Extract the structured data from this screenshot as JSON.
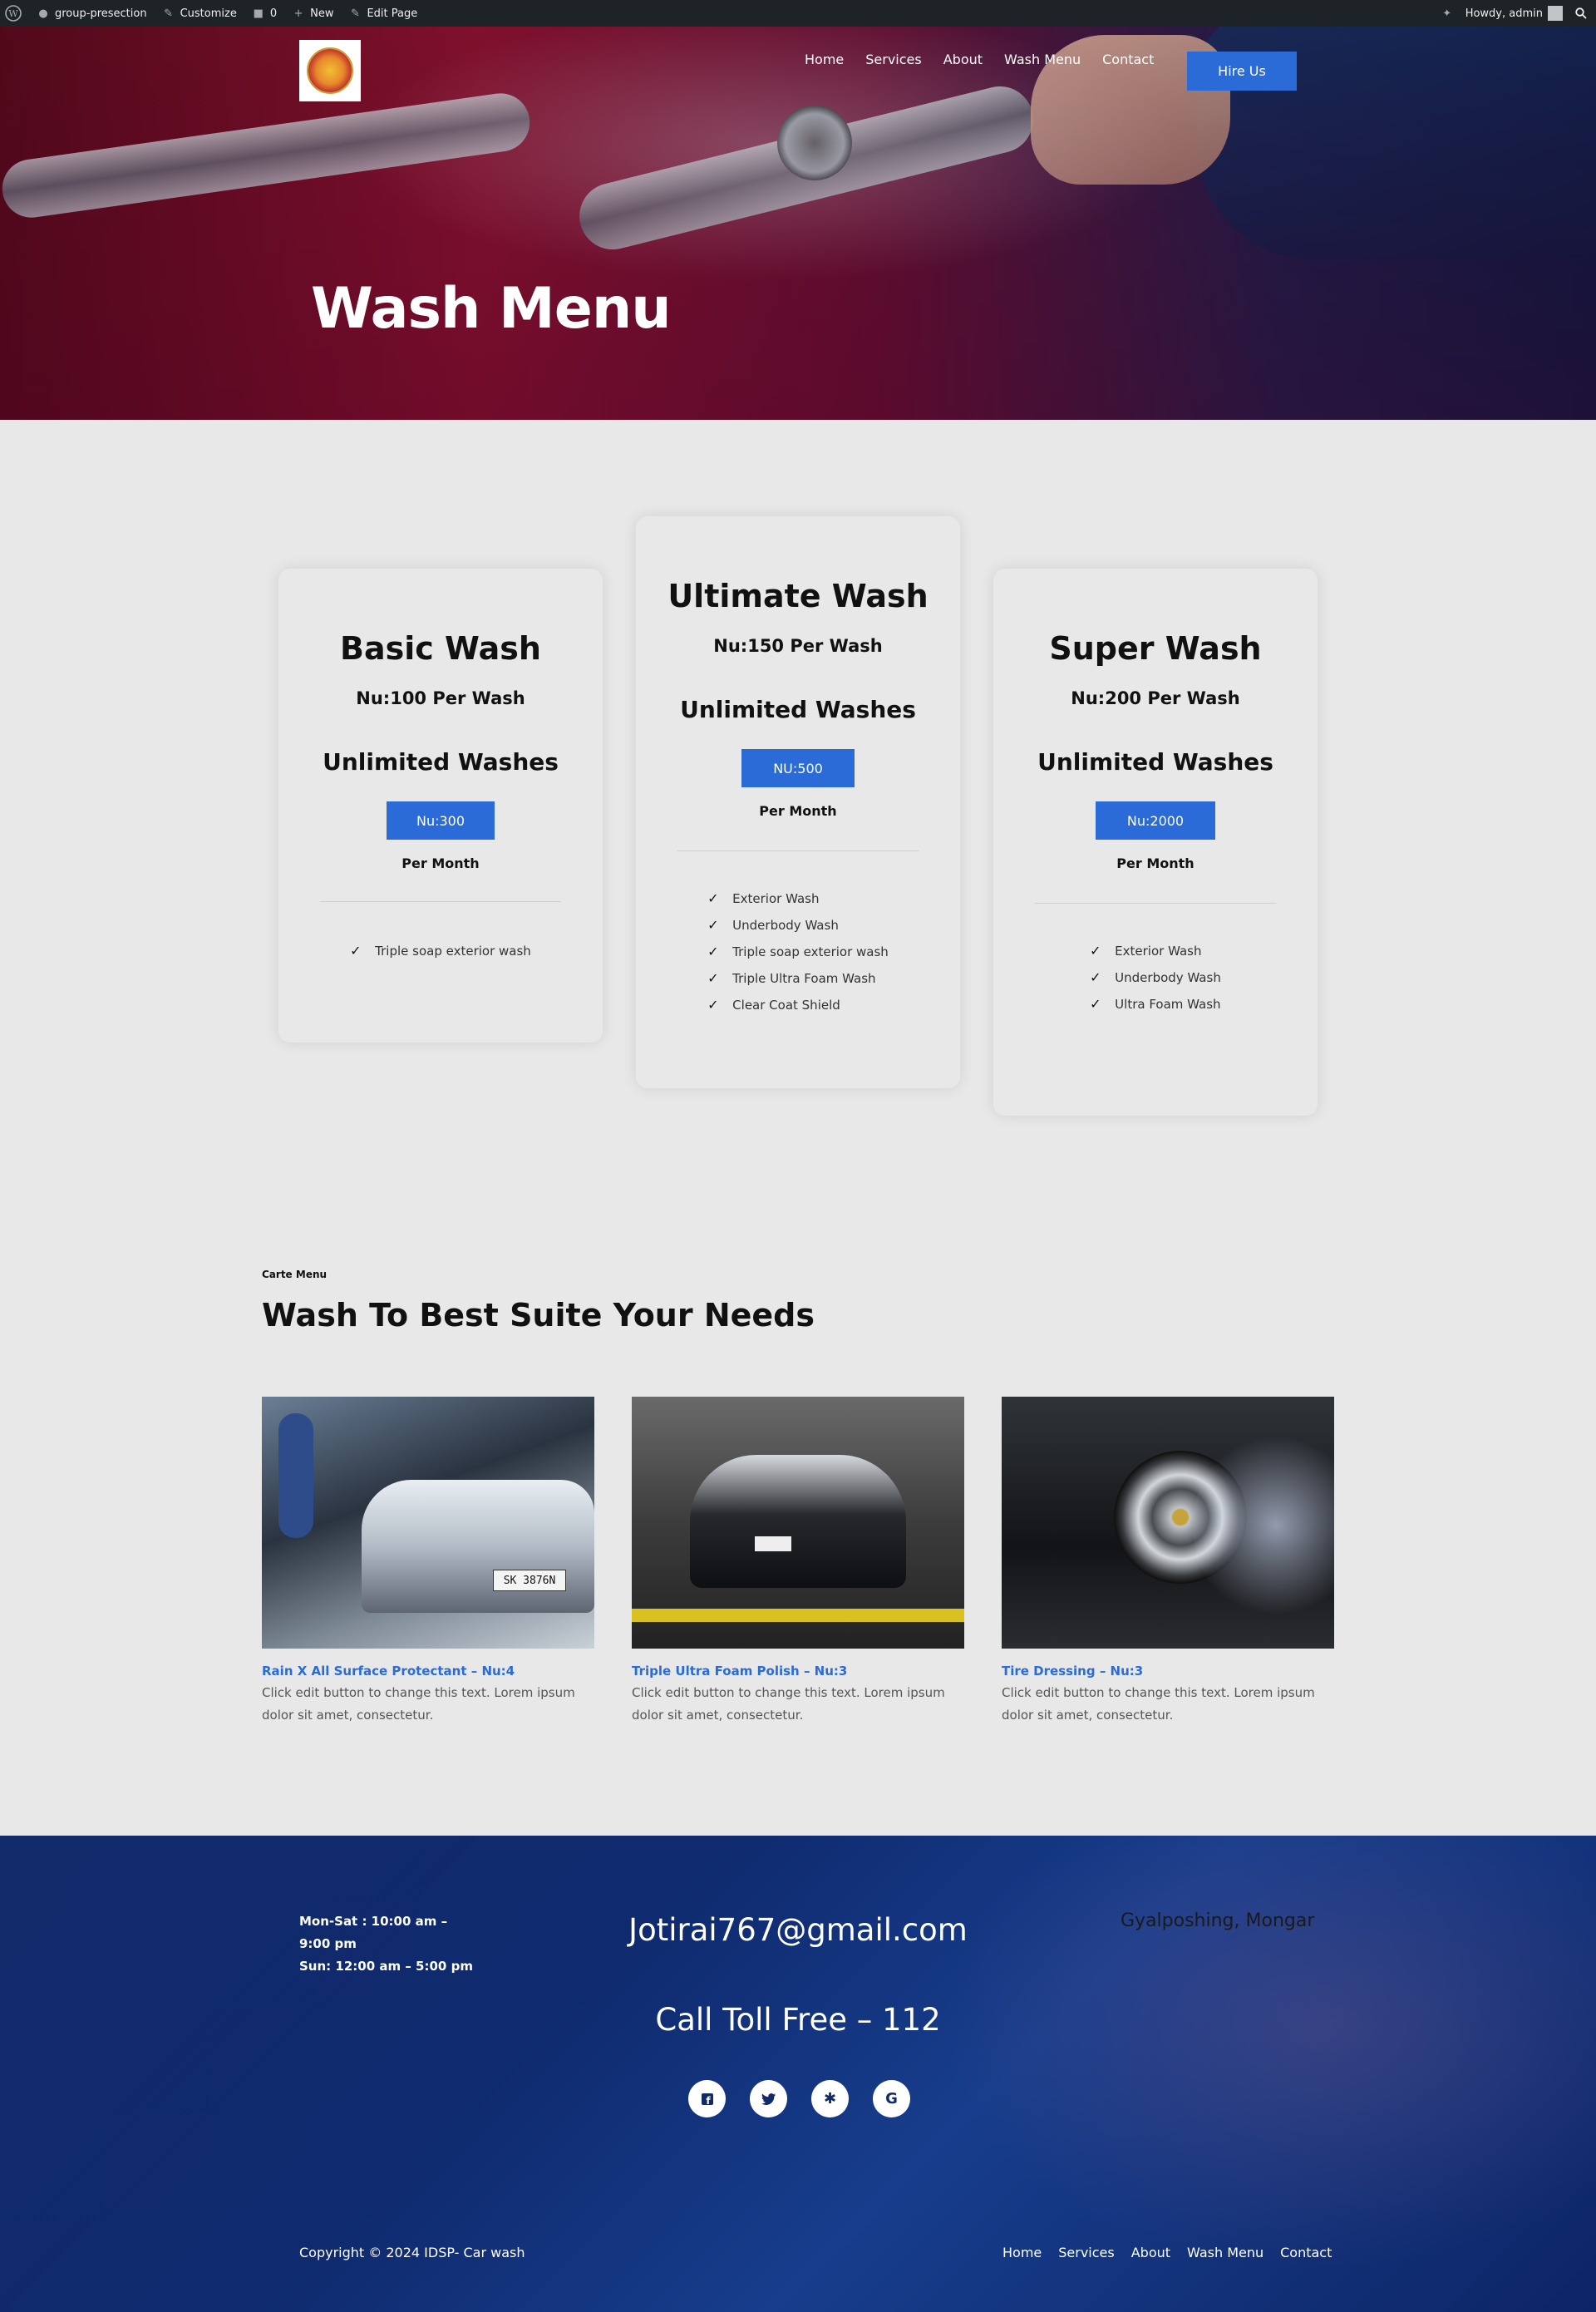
{
  "adminbar": {
    "site": "group-presection",
    "customize": "Customize",
    "comments_count": "0",
    "new": "New",
    "edit_page": "Edit Page",
    "howdy": "Howdy, admin"
  },
  "nav": {
    "items": [
      "Home",
      "Services",
      "About",
      "Wash Menu",
      "Contact"
    ],
    "cta": "Hire Us"
  },
  "hero": {
    "title": "Wash Menu"
  },
  "plans": [
    {
      "title": "Basic Wash",
      "price": "Nu:100 Per Wash",
      "unlimited": "Unlimited Washes",
      "button": "Nu:300",
      "period": "Per Month",
      "features": [
        "Triple soap exterior wash"
      ]
    },
    {
      "title": "Ultimate Wash",
      "price": "Nu:150 Per Wash",
      "unlimited": "Unlimited Washes",
      "button": "NU:500",
      "period": "Per Month",
      "features": [
        "Exterior Wash",
        "Underbody Wash",
        "Triple soap exterior wash",
        "Triple Ultra Foam Wash",
        "Clear Coat Shield"
      ]
    },
    {
      "title": "Super Wash",
      "price": "Nu:200 Per Wash",
      "unlimited": "Unlimited Washes",
      "button": "Nu:2000",
      "period": "Per Month",
      "features": [
        "Exterior Wash",
        "Underbody Wash",
        "Ultra Foam Wash"
      ]
    }
  ],
  "carte": {
    "eyebrow": "Carte Menu",
    "title": "Wash To Best Suite Your Needs",
    "items": [
      {
        "title": "Rain X All Surface Protectant – Nu:4",
        "text": "Click edit button to change this text. Lorem ipsum dolor sit amet, consectetur.",
        "plate": "SK 3876N"
      },
      {
        "title": "Triple Ultra Foam Polish – Nu:3",
        "text": "Click edit button to change this text. Lorem ipsum dolor sit amet, consectetur."
      },
      {
        "title": "Tire Dressing – Nu:3",
        "text": "Click edit button to change this text. Lorem ipsum dolor sit amet, consectetur."
      }
    ]
  },
  "footer": {
    "hours_line1": "Mon-Sat : 10:00 am – 9:00 pm",
    "hours_line2": "Sun: 12:00 am – 5:00 pm",
    "email": "Jotirai767@gmail.com",
    "address": "Gyalposhing, Mongar",
    "tollfree": "Call Toll Free – 112",
    "socials": [
      "facebook-icon",
      "twitter-icon",
      "yelp-icon",
      "google-icon"
    ],
    "copyright": "Copyright © 2024 IDSP- Car wash",
    "nav": [
      "Home",
      "Services",
      "About",
      "Wash Menu",
      "Contact"
    ]
  },
  "colors": {
    "accent": "#2a6bd8",
    "footer_bg": "#102a6a",
    "page_bg": "#e8e8e8",
    "adminbar_bg": "#1d2327"
  }
}
